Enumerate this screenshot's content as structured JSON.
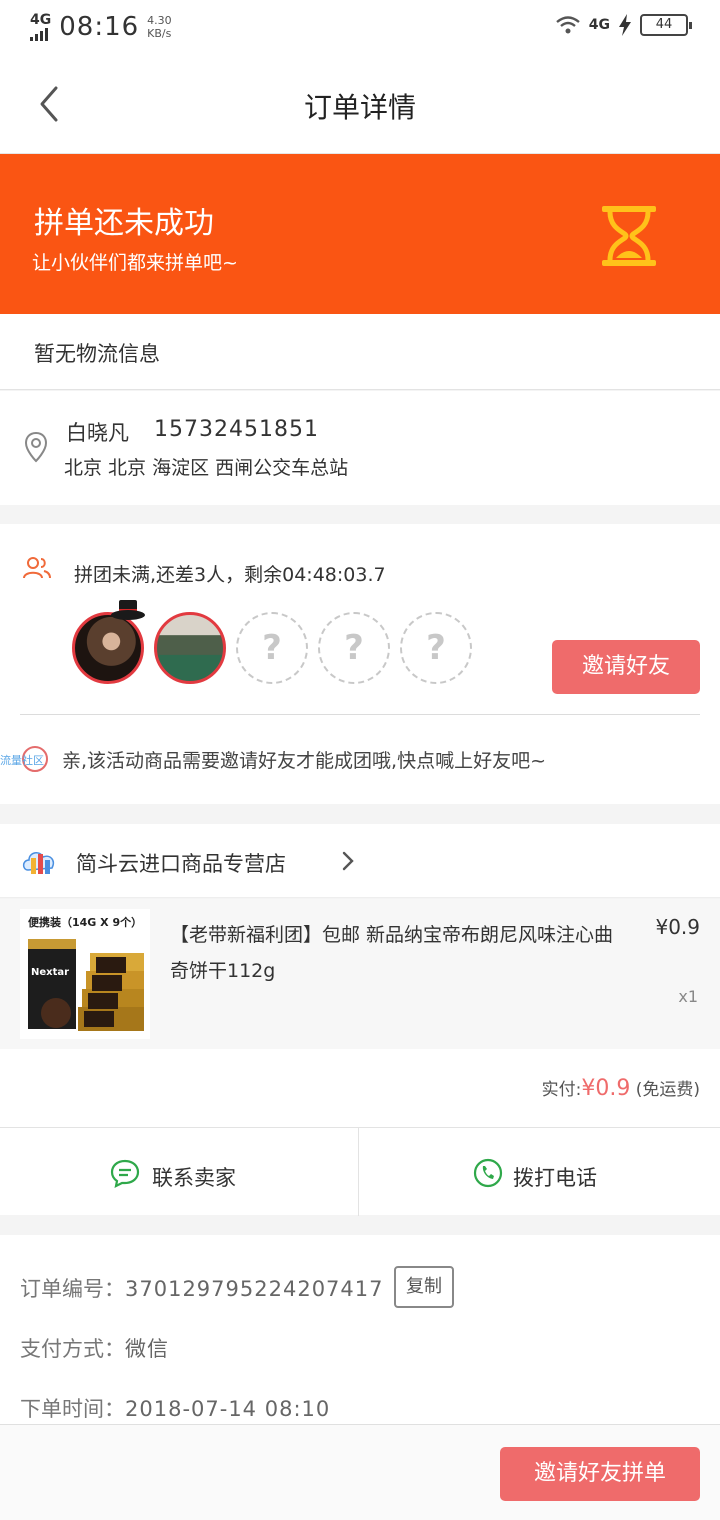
{
  "status_bar": {
    "network": "4G",
    "time": "08:16",
    "speed_value": "4.30",
    "speed_unit": "KB/s",
    "network_right": "4G",
    "battery": "44"
  },
  "nav": {
    "title": "订单详情"
  },
  "banner": {
    "title": "拼单还未成功",
    "subtitle": "让小伙伴们都来拼单吧~",
    "background": "#fa5513",
    "icon": "hourglass-icon"
  },
  "logistics": {
    "text": "暂无物流信息"
  },
  "address": {
    "name": "白晓凡",
    "phone": "15732451851",
    "line": "北京 北京 海淀区 西闸公交车总站"
  },
  "group": {
    "status": "拼团未满,还差3人，剩余04:48:03.7",
    "empty_slot_label": "?",
    "invite_label": "邀请好友",
    "tip": "亲,该活动商品需要邀请好友才能成团哦,快点喊上好友吧~",
    "watermark": "流量社区",
    "accent": "#ef6b6b"
  },
  "shop": {
    "name": "简斗云进口商品专营店"
  },
  "product": {
    "title": "【老带新福利团】包邮 新品纳宝帝布朗尼风味注心曲奇饼干112g",
    "price": "¥0.9",
    "quantity": "x1",
    "image_banner": "便携装（14G X 9个）",
    "image_brand": "Nextar"
  },
  "payment": {
    "label": "实付:",
    "amount": "¥0.9",
    "note": "(免运费)"
  },
  "contact": {
    "seller_label": "联系卖家",
    "phone_label": "拨打电话"
  },
  "order_info": {
    "number_label": "订单编号：",
    "number": "370129795224207417",
    "copy_label": "复制",
    "pay_method_label": "支付方式：",
    "pay_method": "微信",
    "time_label": "下单时间：",
    "time": "2018-07-14 08:10"
  },
  "bottom": {
    "invite_label": "邀请好友拼单"
  }
}
